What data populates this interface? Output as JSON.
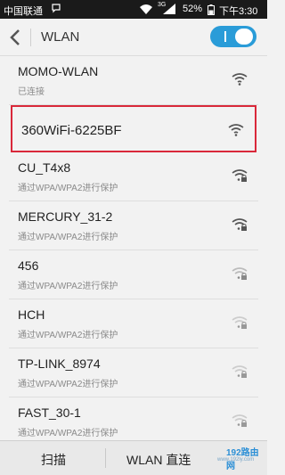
{
  "status_bar": {
    "carrier": "中国联通",
    "network": "3G",
    "battery": "52%",
    "time": "下午3:30",
    "icons": [
      "message-icon",
      "wifi-icon",
      "signal-icon",
      "battery-icon"
    ]
  },
  "title_bar": {
    "title": "WLAN",
    "toggle_state": "on",
    "accent": "#2a9cd8"
  },
  "networks": [
    {
      "ssid": "MOMO-WLAN",
      "status": "已连接",
      "signal": "strong",
      "locked": false
    },
    {
      "ssid": "360WiFi-6225BF",
      "status": "",
      "signal": "strong",
      "locked": false,
      "highlighted": true
    },
    {
      "ssid": "CU_T4x8",
      "status": "通过WPA/WPA2进行保护",
      "signal": "strong",
      "locked": true
    },
    {
      "ssid": "MERCURY_31-2",
      "status": "通过WPA/WPA2进行保护",
      "signal": "strong",
      "locked": true
    },
    {
      "ssid": "456",
      "status": "通过WPA/WPA2进行保护",
      "signal": "weak",
      "locked": true
    },
    {
      "ssid": "HCH",
      "status": "通过WPA/WPA2进行保护",
      "signal": "weak",
      "locked": true
    },
    {
      "ssid": "TP-LINK_8974",
      "status": "通过WPA/WPA2进行保护",
      "signal": "weak",
      "locked": true
    },
    {
      "ssid": "FAST_30-1",
      "status": "通过WPA/WPA2进行保护",
      "signal": "weak",
      "locked": true
    }
  ],
  "bottom_bar": {
    "scan_label": "扫描",
    "direct_label": "WLAN 直连"
  },
  "watermark": {
    "text": "192路由网",
    "sub": "www.192ly.com"
  },
  "colors": {
    "highlight": "#d9283a"
  }
}
